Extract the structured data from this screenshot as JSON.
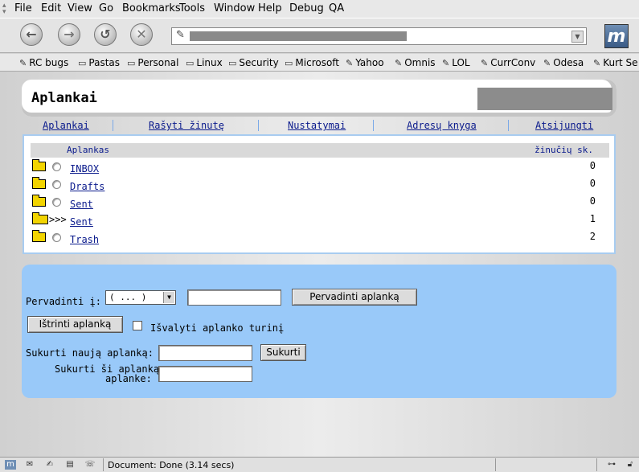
{
  "menu": [
    "File",
    "Edit",
    "View",
    "Go",
    "Bookmarks",
    "Tools",
    "Window",
    "Help",
    "Debug",
    "QA"
  ],
  "bookmarks": [
    {
      "label": "RC bugs",
      "icon": "bookmark-icon"
    },
    {
      "label": "Pastas",
      "icon": "folder-icon"
    },
    {
      "label": "Personal",
      "icon": "folder-icon"
    },
    {
      "label": "Linux",
      "icon": "folder-icon"
    },
    {
      "label": "Security",
      "icon": "folder-icon"
    },
    {
      "label": "Microsoft",
      "icon": "folder-icon"
    },
    {
      "label": "Yahoo",
      "icon": "bookmark-icon"
    },
    {
      "label": "Omnis",
      "icon": "bookmark-icon"
    },
    {
      "label": "LOL",
      "icon": "bookmark-icon"
    },
    {
      "label": "CurrConv",
      "icon": "bookmark-icon"
    },
    {
      "label": "Odesa",
      "icon": "bookmark-icon"
    },
    {
      "label": "Kurt Se",
      "icon": "bookmark-icon"
    }
  ],
  "page": {
    "title": "Aplankai"
  },
  "nav": {
    "folders": "Aplankai",
    "compose": "Rašyti žinutę",
    "options": "Nustatymai",
    "addressbook": "Adresų knyga",
    "signout": "Atsijungti"
  },
  "table": {
    "col_folder": "Aplankas",
    "col_count": "žinučių sk.",
    "rows": [
      {
        "name": "INBOX",
        "count": "0",
        "current": false
      },
      {
        "name": "Drafts",
        "count": "0",
        "current": false
      },
      {
        "name": "Sent",
        "count": "0",
        "current": false
      },
      {
        "name": "Sent",
        "count": "1",
        "current": true,
        "marker": ">>>"
      },
      {
        "name": "Trash",
        "count": "2",
        "current": false
      }
    ]
  },
  "actions": {
    "rename_label": "Pervadinti į:",
    "rename_select": "( ... )",
    "rename_button": "Pervadinti aplanką",
    "delete_button": "Ištrinti aplanką",
    "empty_label": "Išvalyti aplanko turinį",
    "create_label": "Sukurti naują aplanką:",
    "create_button": "Sukurti",
    "create_in_label_1": "Sukurti ši aplanką",
    "create_in_label_2": "aplanke:"
  },
  "status": {
    "text": "Document: Done (3.14 secs)"
  }
}
